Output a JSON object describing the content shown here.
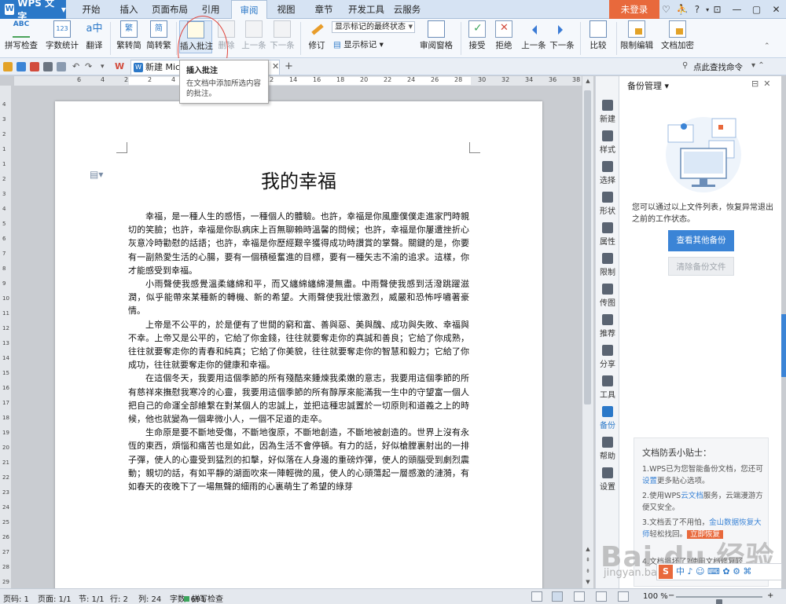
{
  "menubar": {
    "app_name": "WPS 文字",
    "tabs": [
      {
        "label": "开始"
      },
      {
        "label": "插入"
      },
      {
        "label": "页面布局"
      },
      {
        "label": "引用"
      },
      {
        "label": "审阅"
      },
      {
        "label": "视图"
      },
      {
        "label": "章节"
      },
      {
        "label": "开发工具"
      },
      {
        "label": "云服务"
      }
    ],
    "active_tab": "审阅",
    "login_label": "未登录"
  },
  "ribbon": {
    "spell_check": "拼写检查",
    "word_count": "字数统计",
    "translate": "翻译",
    "to_traditional": "繁转简",
    "to_simplified": "简转繁",
    "insert_comment": "插入批注",
    "delete": "删除",
    "prev": "上一条",
    "next": "下一条",
    "revise": "修订",
    "markup_mode": "显示标记的最终状态",
    "show_markup": "显示标记",
    "review_pane": "审阅窗格",
    "accept": "接受",
    "reject": "拒绝",
    "prev2": "上一条",
    "next2": "下一条",
    "compare": "比较",
    "restrict_edit": "限制编辑",
    "doc_encrypt": "文档加密"
  },
  "qabar": {
    "doc_tab": "新建 Micr",
    "search_link": "点此查找命令"
  },
  "tooltip": {
    "title": "插入批注",
    "desc": "在文档中添加所选内容的批注。"
  },
  "ruler": {
    "h_numbers": [
      "6",
      "4",
      "2",
      "2",
      "4",
      "6",
      "8",
      "10",
      "12",
      "14",
      "16",
      "18",
      "20",
      "22",
      "24",
      "26",
      "28",
      "30",
      "32",
      "34",
      "36",
      "38"
    ],
    "v_numbers": [
      "4",
      "3",
      "2",
      "1",
      "1",
      "2",
      "3",
      "4",
      "5",
      "6",
      "7",
      "8",
      "9",
      "10",
      "11",
      "12",
      "13",
      "14",
      "15",
      "16",
      "17",
      "18",
      "19",
      "20",
      "21",
      "22",
      "23",
      "24",
      "25",
      "26",
      "27",
      "28",
      "29"
    ]
  },
  "document": {
    "title": "我的幸福",
    "paragraphs": [
      "幸福，是一種人生的感悟，一種個人的體驗。也許，幸福是你風塵僕僕走進家門時親切的笑臉；也許，幸福是你臥病床上百無聊賴時溫馨的問候；也許，幸福是你屢遭挫折心灰意冷時勸慰的話語；也許，幸福是你歷經艱辛獲得成功時讚賞的掌聲。關鍵的是，你要有一副熱愛生活的心腸，要有一個積極奮進的目標，要有一種矢志不渝的追求。這樣，你才能感受到幸福。",
      "小雨聲使我感覺溫柔纏綿和平，而又纏綿纏綿漫無盡。中雨聲使我感到活潑跳躍滋潤，似乎能帶來某種新的轉機、新的希望。大雨聲使我壯懷激烈，威嚴和恐怖呼嘯著豪情。",
      "上帝是不公平的，於是便有了世間的窮和富、善與惡、美與醜、成功與失敗、幸福與不幸。上帝又是公平的，它給了你金錢，往往就要奪走你的真誠和善良；它給了你成熟，往往就要奪走你的青春和純真；它給了你美貌，往往就要奪走你的智慧和毅力；它給了你成功，往往就要奪走你的健康和幸福。",
      "在這個冬天，我要用這個季節的所有殘酷來鍾煉我柔嫩的意志，我要用這個季節的所有慈祥來撫慰我寒冷的心靈，我要用這個季節的所有醇厚來能滿我一生中的守望富一個人把自己的命運全部維繫在對某個人的忠誠上，並把這種忠誠置於一切原則和道義之上的時候，他也就變為一個卑微小人，一個不足道的走卒。",
      "生命原是要不斷地受傷，不斷地復原，不斷地創造，不斷地被創造的。世界上沒有永恆的東西，煩惱和痛苦也是如此，因為生活不會停頓。有力的話，好似槍膛裏射出的一排子彈，使人的心靈受到猛烈的扣擊，好似落在人身邊的重磅炸彈，使人的頭腦受到劇烈震動；親切的話，有如平靜的湖面吹來一陣輕微的風，使人的心頭蕩起一層感激的漣漪，有如春天的夜晚下了一場無聲的細雨的心裏萌生了希望的綠芽"
    ]
  },
  "sidebar": {
    "items": [
      {
        "label": "新建"
      },
      {
        "label": "样式"
      },
      {
        "label": "选择"
      },
      {
        "label": "形状"
      },
      {
        "label": "属性"
      },
      {
        "label": "限制"
      },
      {
        "label": "传图"
      },
      {
        "label": "推荐"
      },
      {
        "label": "分享"
      },
      {
        "label": "工具"
      },
      {
        "label": "备份"
      },
      {
        "label": "帮助"
      },
      {
        "label": "设置"
      }
    ]
  },
  "panel": {
    "title": "备份管理",
    "desc": "您可以通过以上文件列表，恢复异常退出之前的工作状态。",
    "btn_view": "查看其他备份",
    "btn_clear": "清除备份文件",
    "tips_title": "文档防丢小贴士：",
    "tip1_a": "1.WPS已为您智能备份文档，您还可",
    "tip1_link": "设置",
    "tip1_b": "更多贴心选项。",
    "tip2_a": "2.使用WPS",
    "tip2_link": "云文档",
    "tip2_b": "服务，云端漫游方便又安全。",
    "tip3_a": "3.文档丢了不用怕，",
    "tip3_link": "金山数据恢复大师",
    "tip3_b": "轻松找回。",
    "tip3_badge": "立即恢复",
    "tip4": "4.文档损坏了?使用文档修复轻"
  },
  "statusbar": {
    "page_code": "页码: 1",
    "pages": "页面: 1/1",
    "section": "节: 1/1",
    "row": "行: 2",
    "col": "列: 24",
    "word_count": "字数: 691",
    "spell": "拼写检查",
    "zoom": "100 %",
    "zoom_fraction": 0.5
  },
  "watermark": {
    "logo": "Bai du 经验",
    "url": "jingyan.baidu.com"
  }
}
